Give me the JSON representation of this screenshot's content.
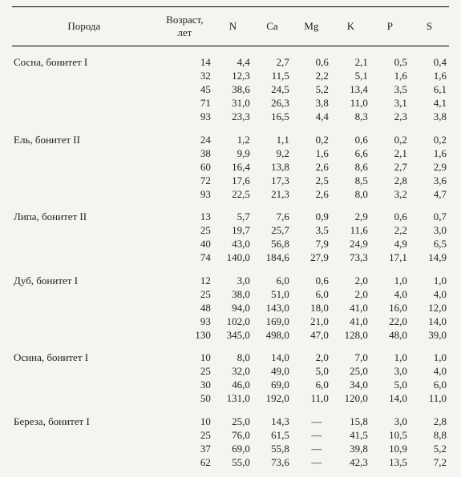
{
  "headers": {
    "species": "Порода",
    "age": "Возраст,\nлет",
    "N": "N",
    "Ca": "Ca",
    "Mg": "Mg",
    "K": "K",
    "P": "P",
    "S": "S"
  },
  "chart_data": {
    "type": "table",
    "columns": [
      "Порода",
      "Возраст, лет",
      "N",
      "Ca",
      "Mg",
      "K",
      "P",
      "S"
    ],
    "groups": [
      {
        "species": "Сосна, бонитет I",
        "rows": [
          {
            "age": 14,
            "N": "4,4",
            "Ca": "2,7",
            "Mg": "0,6",
            "K": "2,1",
            "P": "0,5",
            "S": "0,4"
          },
          {
            "age": 32,
            "N": "12,3",
            "Ca": "11,5",
            "Mg": "2,2",
            "K": "5,1",
            "P": "1,6",
            "S": "1,6"
          },
          {
            "age": 45,
            "N": "38,6",
            "Ca": "24,5",
            "Mg": "5,2",
            "K": "13,4",
            "P": "3,5",
            "S": "6,1"
          },
          {
            "age": 71,
            "N": "31,0",
            "Ca": "26,3",
            "Mg": "3,8",
            "K": "11,0",
            "P": "3,1",
            "S": "4,1"
          },
          {
            "age": 93,
            "N": "23,3",
            "Ca": "16,5",
            "Mg": "4,4",
            "K": "8,3",
            "P": "2,3",
            "S": "3,8"
          }
        ]
      },
      {
        "species": "Ель, бонитет II",
        "rows": [
          {
            "age": 24,
            "N": "1,2",
            "Ca": "1,1",
            "Mg": "0,2",
            "K": "0,6",
            "P": "0,2",
            "S": "0,2"
          },
          {
            "age": 38,
            "N": "9,9",
            "Ca": "9,2",
            "Mg": "1,6",
            "K": "6,6",
            "P": "2,1",
            "S": "1,6"
          },
          {
            "age": 60,
            "N": "16,4",
            "Ca": "13,8",
            "Mg": "2,6",
            "K": "8,6",
            "P": "2,7",
            "S": "2,9"
          },
          {
            "age": 72,
            "N": "17,6",
            "Ca": "17,3",
            "Mg": "2,5",
            "K": "8,5",
            "P": "2,8",
            "S": "3,6"
          },
          {
            "age": 93,
            "N": "22,5",
            "Ca": "21,3",
            "Mg": "2,6",
            "K": "8,0",
            "P": "3,2",
            "S": "4,7"
          }
        ]
      },
      {
        "species": "Липа, бонитет II",
        "rows": [
          {
            "age": 13,
            "N": "5,7",
            "Ca": "7,6",
            "Mg": "0,9",
            "K": "2,9",
            "P": "0,6",
            "S": "0,7"
          },
          {
            "age": 25,
            "N": "19,7",
            "Ca": "25,7",
            "Mg": "3,5",
            "K": "11,6",
            "P": "2,2",
            "S": "3,0"
          },
          {
            "age": 40,
            "N": "43,0",
            "Ca": "56,8",
            "Mg": "7,9",
            "K": "24,9",
            "P": "4,9",
            "S": "6,5"
          },
          {
            "age": 74,
            "N": "140,0",
            "Ca": "184,6",
            "Mg": "27,9",
            "K": "73,3",
            "P": "17,1",
            "S": "14,9"
          }
        ]
      },
      {
        "species": "Дуб, бонитет I",
        "rows": [
          {
            "age": 12,
            "N": "3,0",
            "Ca": "6,0",
            "Mg": "0,6",
            "K": "2,0",
            "P": "1,0",
            "S": "1,0"
          },
          {
            "age": 25,
            "N": "38,0",
            "Ca": "51,0",
            "Mg": "6,0",
            "K": "2,0",
            "P": "4,0",
            "S": "4,0"
          },
          {
            "age": 48,
            "N": "94,0",
            "Ca": "143,0",
            "Mg": "18,0",
            "K": "41,0",
            "P": "16,0",
            "S": "12,0"
          },
          {
            "age": 93,
            "N": "102,0",
            "Ca": "169,0",
            "Mg": "21,0",
            "K": "41,0",
            "P": "22,0",
            "S": "14,0"
          },
          {
            "age": 130,
            "N": "345,0",
            "Ca": "498,0",
            "Mg": "47,0",
            "K": "128,0",
            "P": "48,0",
            "S": "39,0"
          }
        ]
      },
      {
        "species": "Осина, бонитет I",
        "rows": [
          {
            "age": 10,
            "N": "8,0",
            "Ca": "14,0",
            "Mg": "2,0",
            "K": "7,0",
            "P": "1,0",
            "S": "1,0"
          },
          {
            "age": 25,
            "N": "32,0",
            "Ca": "49,0",
            "Mg": "5,0",
            "K": "25,0",
            "P": "3,0",
            "S": "4,0"
          },
          {
            "age": 30,
            "N": "46,0",
            "Ca": "69,0",
            "Mg": "6,0",
            "K": "34,0",
            "P": "5,0",
            "S": "6,0"
          },
          {
            "age": 50,
            "N": "131,0",
            "Ca": "192,0",
            "Mg": "11,0",
            "K": "120,0",
            "P": "14,0",
            "S": "11,0"
          }
        ]
      },
      {
        "species": "Береза, бонитет I",
        "rows": [
          {
            "age": 10,
            "N": "25,0",
            "Ca": "14,3",
            "Mg": "—",
            "K": "15,8",
            "P": "3,0",
            "S": "2,8"
          },
          {
            "age": 25,
            "N": "76,0",
            "Ca": "61,5",
            "Mg": "—",
            "K": "41,5",
            "P": "10,5",
            "S": "8,8"
          },
          {
            "age": 37,
            "N": "69,0",
            "Ca": "55,8",
            "Mg": "—",
            "K": "39,8",
            "P": "10,9",
            "S": "5,2"
          },
          {
            "age": 62,
            "N": "55,0",
            "Ca": "73,6",
            "Mg": "—",
            "K": "42,3",
            "P": "13,5",
            "S": "7,2"
          }
        ]
      }
    ]
  }
}
